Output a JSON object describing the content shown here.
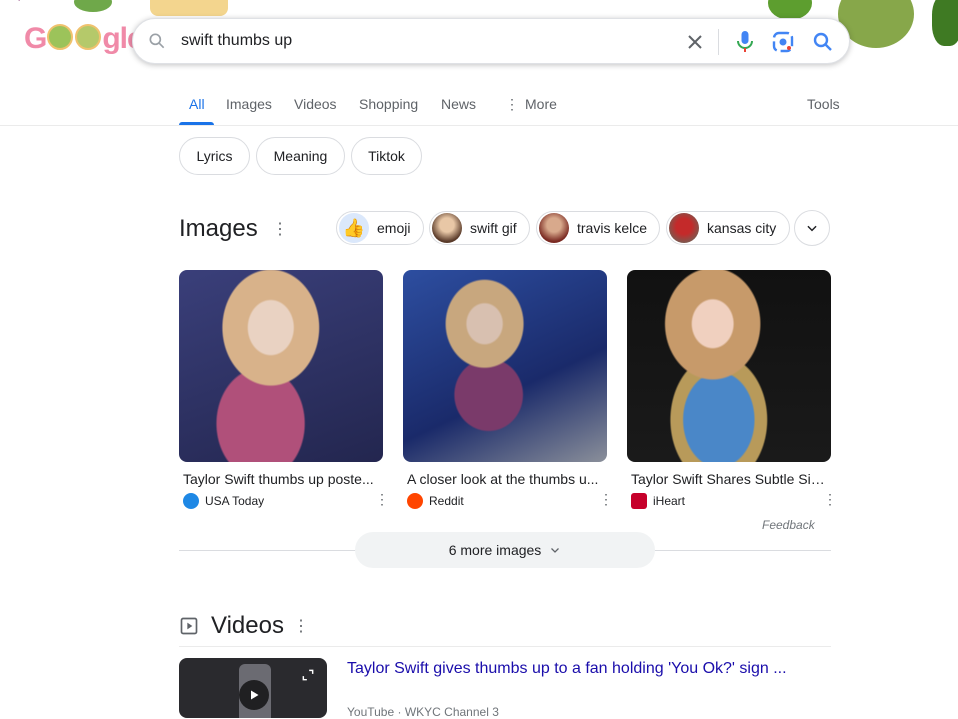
{
  "logo": {
    "text_pre": "G",
    "text_post": "gle"
  },
  "search": {
    "query": "swift thumbs up",
    "icons": [
      "search-icon",
      "close-icon",
      "mic-icon",
      "lens-icon",
      "search-icon"
    ]
  },
  "tabs": [
    "All",
    "Images",
    "Videos",
    "Shopping",
    "News",
    "More"
  ],
  "tools_label": "Tools",
  "chips": [
    "Lyrics",
    "Meaning",
    "Tiktok"
  ],
  "images": {
    "title": "Images",
    "related": [
      "emoji",
      "swift gif",
      "travis kelce",
      "kansas city"
    ],
    "results": [
      {
        "caption": "Taylor Swift thumbs up poste...",
        "source": "USA Today",
        "source_color": "#1e88e5"
      },
      {
        "caption": "A closer look at the thumbs u...",
        "source": "Reddit",
        "source_color": "#ff4500"
      },
      {
        "caption": "Taylor Swift Shares Subtle Sig...",
        "source": "iHeart",
        "source_color": "#c6002b"
      }
    ],
    "feedback": "Feedback",
    "more_label": "6 more images"
  },
  "videos": {
    "title": "Videos",
    "first_title": "Taylor Swift gives thumbs up to a fan holding 'You Ok?' sign ...",
    "first_meta": "YouTube · WKYC Channel 3"
  },
  "colors": {
    "accent": "#1a73e8",
    "link": "#1a0dab",
    "logo": "#f08aa8"
  }
}
